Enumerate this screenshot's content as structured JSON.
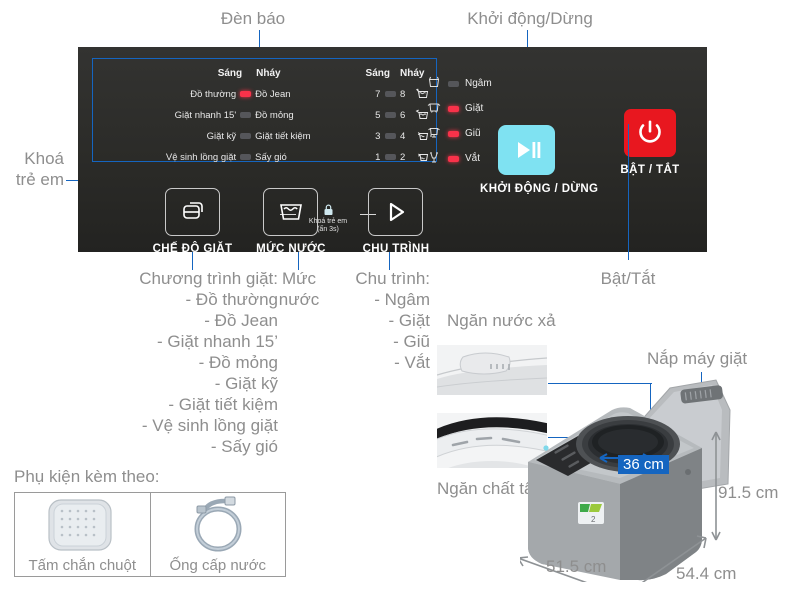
{
  "annotations": {
    "den_bao": "Đèn báo",
    "khoi_dong_dung": "Khởi động/Dừng",
    "khoa_tre_em_l1": "Khoá",
    "khoa_tre_em_l2": "trẻ em",
    "bat_tat": "Bật/Tắt",
    "ngan_nuoc_xa": "Ngăn nước xả",
    "ngan_chat_tay": "Ngăn chất tẩy",
    "nap_may_giat": "Nắp máy giặt"
  },
  "display": {
    "headers": [
      "Sáng",
      "Nháy",
      "Sáng",
      "Nháy"
    ],
    "rows": [
      {
        "left_label": "Đồ thường",
        "left_led": "on",
        "right_label": "Đồ Jean",
        "num_left": "7",
        "num_led": "off",
        "num_right": "8",
        "level_icon": "water-level-4"
      },
      {
        "left_label": "Giặt nhanh 15'",
        "left_led": "off",
        "right_label": "Đồ mỏng",
        "num_left": "5",
        "num_led": "off",
        "num_right": "6",
        "level_icon": "water-level-3"
      },
      {
        "left_label": "Giặt kỹ",
        "left_led": "off",
        "right_label": "Giặt tiết kiệm",
        "num_left": "3",
        "num_led": "off",
        "num_right": "4",
        "level_icon": "water-level-2"
      },
      {
        "left_label": "Vệ sinh lồng giặt",
        "left_led": "off",
        "right_label": "Sấy gió",
        "num_left": "1",
        "num_led": "off",
        "num_right": "2",
        "level_icon": "water-level-1"
      }
    ],
    "cycles": [
      {
        "icon": "soak-icon",
        "led": "off",
        "label": "Ngâm"
      },
      {
        "icon": "wash-icon",
        "led": "on",
        "label": "Giặt"
      },
      {
        "icon": "rinse-icon",
        "led": "on",
        "label": "Giũ"
      },
      {
        "icon": "spin-icon",
        "led": "on",
        "label": "Vắt"
      }
    ]
  },
  "buttons": {
    "che_do_giat": "CHẾ ĐỘ GIẶT",
    "muc_nuoc": "MỨC NƯỚC",
    "chu_trinh": "CHU TRÌNH",
    "khoi_dong_dung": "KHỞI ĐỘNG / DỪNG",
    "bat_tat": "BẬT / TẮT",
    "child_lock_label": "Khoá trẻ em",
    "child_lock_hint": "(ấn 3s)"
  },
  "legend": {
    "programs_title": "Chương trình giặt:",
    "programs": [
      "- Đồ thường",
      "- Đồ Jean",
      "- Giặt nhanh 15’",
      "- Đồ mỏng",
      "- Giặt kỹ",
      "- Giặt tiết kiệm",
      "- Vệ sinh lồng giặt",
      "- Sấy gió"
    ],
    "water_title_l1": "Mức",
    "water_title_l2": "nước",
    "cycle_title": "Chu trình:",
    "cycles": [
      "- Ngâm",
      "- Giặt",
      "- Giũ",
      "- Vắt"
    ]
  },
  "accessories": {
    "title": "Phụ kiện kèm theo:",
    "items": [
      {
        "label": "Tấm chắn chuột",
        "icon": "mouse-guard-plate"
      },
      {
        "label": "Ống cấp nước",
        "icon": "water-inlet-hose"
      }
    ]
  },
  "dimensions": {
    "drum": "36 cm",
    "height": "91.5 cm",
    "width": "51.5 cm",
    "depth": "54.4 cm"
  },
  "colors": {
    "accent_blue": "#1565c0",
    "panel_dark": "#2b2b29",
    "led_on": "#f8324a",
    "led_off": "#55565a",
    "start_button": "#7fe2f2",
    "power_button": "#e8171f",
    "annotation_gray": "#8e8e8e"
  }
}
